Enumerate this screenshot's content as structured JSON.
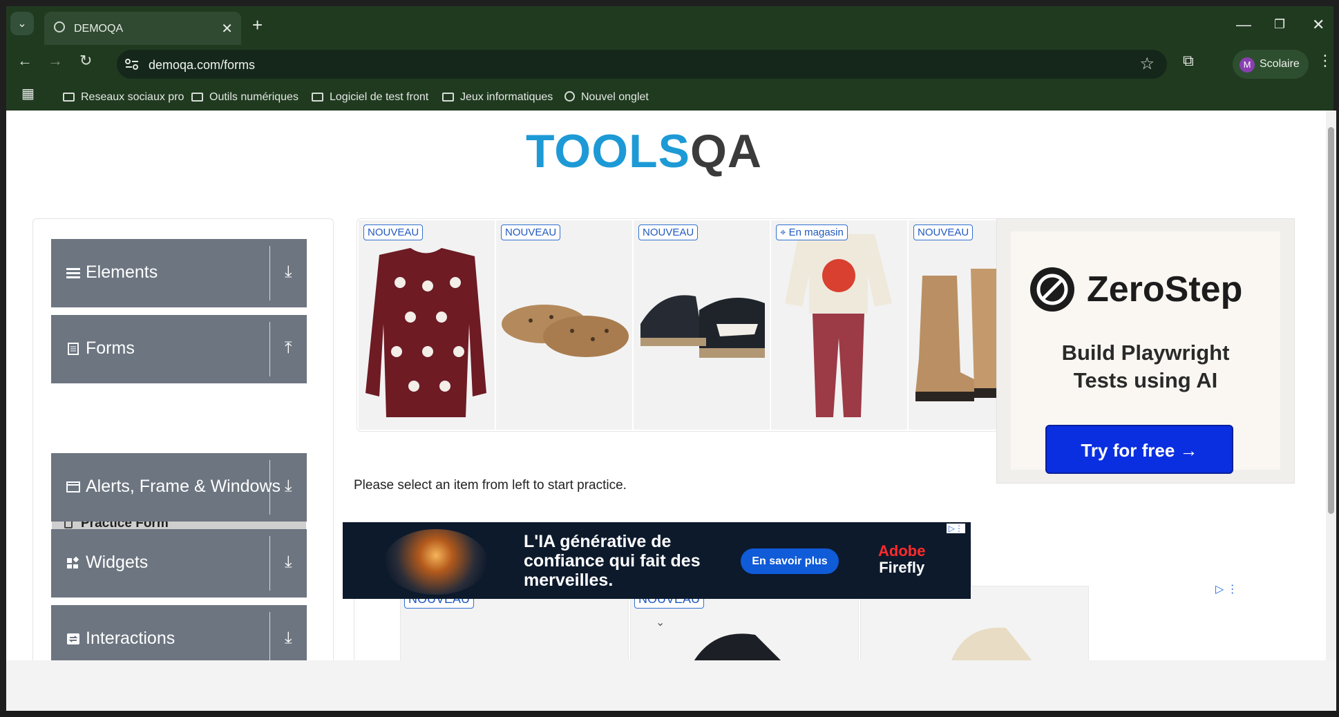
{
  "browser": {
    "tab_title": "DEMOQA",
    "url": "demoqa.com/forms",
    "profile_initial": "M",
    "profile_name": "Scolaire",
    "bookmarks": [
      "Reseaux sociaux pro",
      "Outils numériques",
      "Logiciel de test front",
      "Jeux informatiques",
      "Nouvel onglet"
    ]
  },
  "logo": {
    "part1": "TOOLS",
    "part2": "QA"
  },
  "sidebar": {
    "groups": [
      {
        "label": "Elements",
        "icon": "hamburger-icon",
        "arrow": "download-arrow-icon"
      },
      {
        "label": "Forms",
        "icon": "document-icon",
        "arrow": "upload-arrow-icon"
      },
      {
        "label": "Alerts, Frame & Windows",
        "icon": "window-icon",
        "arrow": "download-arrow-icon"
      },
      {
        "label": "Widgets",
        "icon": "widgets-icon",
        "arrow": "download-arrow-icon"
      },
      {
        "label": "Interactions",
        "icon": "swap-icon",
        "arrow": "download-arrow-icon"
      }
    ],
    "active_item": "Practice Form"
  },
  "main": {
    "instruction": "Please select an item from left to start practice."
  },
  "ads": {
    "top_badges": [
      "NOUVEAU",
      "NOUVEAU",
      "NOUVEAU",
      "En magasin",
      "NOUVEAU"
    ],
    "bottom_badges": [
      "NOUVEAU",
      "NOUVEAU"
    ],
    "zerostep": {
      "name": "ZeroStep",
      "tagline": "Build Playwright Tests using AI",
      "button": "Try for free →"
    },
    "banner": {
      "text": "L'IA générative de confiance qui fait des merveilles.",
      "cta": "En savoir plus",
      "brand1": "Adobe",
      "brand2": "Firefly"
    }
  },
  "colors": {
    "chrome": "#203a20",
    "nav_group": "#6c7580",
    "logo_blue": "#1d9ad6",
    "cta_blue": "#0a2fe0"
  }
}
